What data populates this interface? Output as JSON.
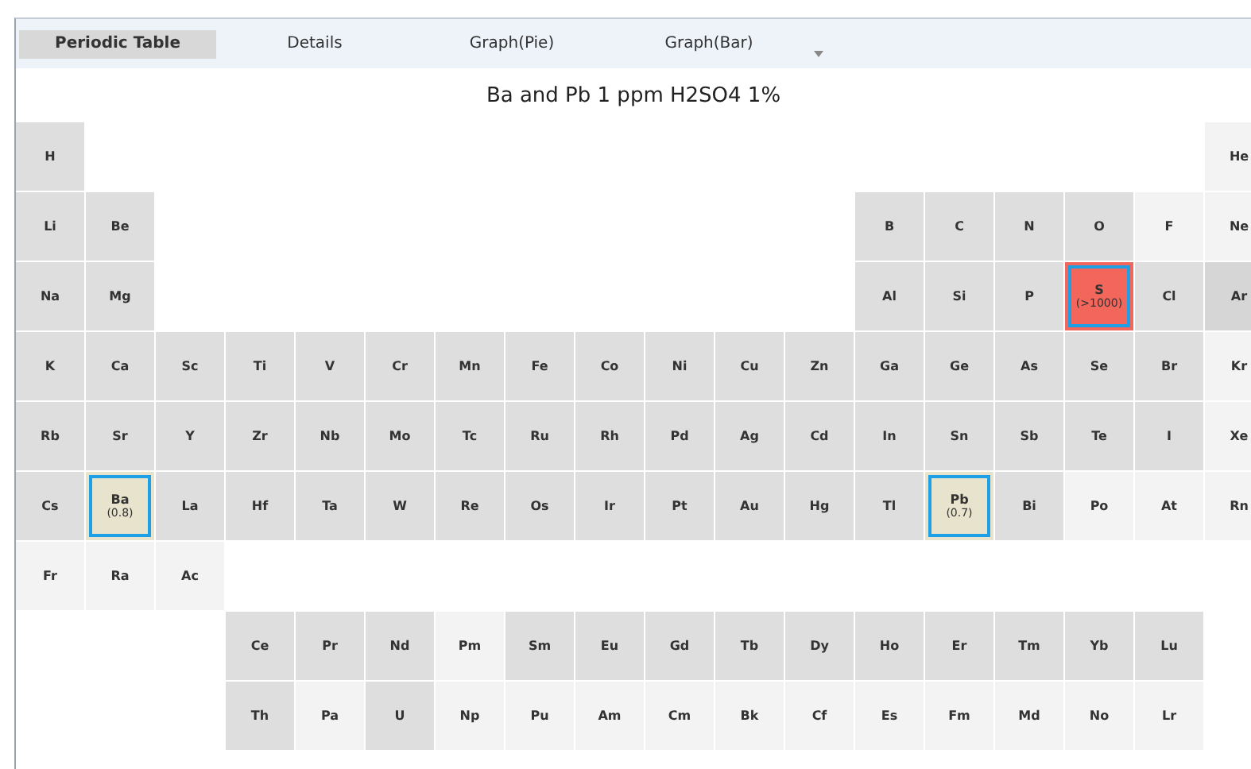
{
  "tabs": [
    {
      "label": "Periodic Table",
      "selected": true
    },
    {
      "label": "Details",
      "selected": false
    },
    {
      "label": "Graph(Pie)",
      "selected": false
    },
    {
      "label": "Graph(Bar)",
      "selected": false
    }
  ],
  "title": "Ba and Pb 1 ppm H2SO4 1%",
  "rows": [
    {
      "cells": [
        {
          "symbol": "H",
          "color": "#dedede",
          "selected": false
        },
        null,
        null,
        null,
        null,
        null,
        null,
        null,
        null,
        null,
        null,
        null,
        null,
        null,
        null,
        null,
        null,
        {
          "symbol": "He",
          "color": "#f3f3f3",
          "selected": false
        }
      ]
    },
    {
      "cells": [
        {
          "symbol": "Li",
          "color": "#dedede",
          "selected": false
        },
        {
          "symbol": "Be",
          "color": "#dedede",
          "selected": false
        },
        null,
        null,
        null,
        null,
        null,
        null,
        null,
        null,
        null,
        null,
        {
          "symbol": "B",
          "color": "#dedede",
          "selected": false
        },
        {
          "symbol": "C",
          "color": "#dedede",
          "selected": false
        },
        {
          "symbol": "N",
          "color": "#dedede",
          "selected": false
        },
        {
          "symbol": "O",
          "color": "#dedede",
          "selected": false
        },
        {
          "symbol": "F",
          "color": "#f3f3f3",
          "selected": false
        },
        {
          "symbol": "Ne",
          "color": "#f3f3f3",
          "selected": false
        }
      ]
    },
    {
      "cells": [
        {
          "symbol": "Na",
          "color": "#dedede",
          "selected": false
        },
        {
          "symbol": "Mg",
          "color": "#dedede",
          "selected": false
        },
        null,
        null,
        null,
        null,
        null,
        null,
        null,
        null,
        null,
        null,
        {
          "symbol": "Al",
          "color": "#dedede",
          "selected": false
        },
        {
          "symbol": "Si",
          "color": "#dedede",
          "selected": false
        },
        {
          "symbol": "P",
          "color": "#dedede",
          "selected": false
        },
        {
          "symbol": "S",
          "value": "(>1000)",
          "color": "#f2665b",
          "selected": true
        },
        {
          "symbol": "Cl",
          "color": "#dedede",
          "selected": false
        },
        {
          "symbol": "Ar",
          "color": "#d6d6d6",
          "selected": false
        }
      ]
    },
    {
      "cells": [
        {
          "symbol": "K",
          "color": "#dedede",
          "selected": false
        },
        {
          "symbol": "Ca",
          "color": "#dedede",
          "selected": false
        },
        {
          "symbol": "Sc",
          "color": "#dedede",
          "selected": false
        },
        {
          "symbol": "Ti",
          "color": "#dedede",
          "selected": false
        },
        {
          "symbol": "V",
          "color": "#dedede",
          "selected": false
        },
        {
          "symbol": "Cr",
          "color": "#dedede",
          "selected": false
        },
        {
          "symbol": "Mn",
          "color": "#dedede",
          "selected": false
        },
        {
          "symbol": "Fe",
          "color": "#dedede",
          "selected": false
        },
        {
          "symbol": "Co",
          "color": "#dedede",
          "selected": false
        },
        {
          "symbol": "Ni",
          "color": "#dedede",
          "selected": false
        },
        {
          "symbol": "Cu",
          "color": "#dedede",
          "selected": false
        },
        {
          "symbol": "Zn",
          "color": "#dedede",
          "selected": false
        },
        {
          "symbol": "Ga",
          "color": "#dedede",
          "selected": false
        },
        {
          "symbol": "Ge",
          "color": "#dedede",
          "selected": false
        },
        {
          "symbol": "As",
          "color": "#dedede",
          "selected": false
        },
        {
          "symbol": "Se",
          "color": "#dedede",
          "selected": false
        },
        {
          "symbol": "Br",
          "color": "#dedede",
          "selected": false
        },
        {
          "symbol": "Kr",
          "color": "#f3f3f3",
          "selected": false
        }
      ]
    },
    {
      "cells": [
        {
          "symbol": "Rb",
          "color": "#dedede",
          "selected": false
        },
        {
          "symbol": "Sr",
          "color": "#dedede",
          "selected": false
        },
        {
          "symbol": "Y",
          "color": "#dedede",
          "selected": false
        },
        {
          "symbol": "Zr",
          "color": "#dedede",
          "selected": false
        },
        {
          "symbol": "Nb",
          "color": "#dedede",
          "selected": false
        },
        {
          "symbol": "Mo",
          "color": "#dedede",
          "selected": false
        },
        {
          "symbol": "Tc",
          "color": "#dedede",
          "selected": false
        },
        {
          "symbol": "Ru",
          "color": "#dedede",
          "selected": false
        },
        {
          "symbol": "Rh",
          "color": "#dedede",
          "selected": false
        },
        {
          "symbol": "Pd",
          "color": "#dedede",
          "selected": false
        },
        {
          "symbol": "Ag",
          "color": "#dedede",
          "selected": false
        },
        {
          "symbol": "Cd",
          "color": "#dedede",
          "selected": false
        },
        {
          "symbol": "In",
          "color": "#dedede",
          "selected": false
        },
        {
          "symbol": "Sn",
          "color": "#dedede",
          "selected": false
        },
        {
          "symbol": "Sb",
          "color": "#dedede",
          "selected": false
        },
        {
          "symbol": "Te",
          "color": "#dedede",
          "selected": false
        },
        {
          "symbol": "I",
          "color": "#dedede",
          "selected": false
        },
        {
          "symbol": "Xe",
          "color": "#f3f3f3",
          "selected": false
        }
      ]
    },
    {
      "cells": [
        {
          "symbol": "Cs",
          "color": "#dedede",
          "selected": false
        },
        {
          "symbol": "Ba",
          "value": "(0.8)",
          "color": "#e7e3cc",
          "selected": true
        },
        {
          "symbol": "La",
          "color": "#dedede",
          "selected": false
        },
        {
          "symbol": "Hf",
          "color": "#dedede",
          "selected": false
        },
        {
          "symbol": "Ta",
          "color": "#dedede",
          "selected": false
        },
        {
          "symbol": "W",
          "color": "#dedede",
          "selected": false
        },
        {
          "symbol": "Re",
          "color": "#dedede",
          "selected": false
        },
        {
          "symbol": "Os",
          "color": "#dedede",
          "selected": false
        },
        {
          "symbol": "Ir",
          "color": "#dedede",
          "selected": false
        },
        {
          "symbol": "Pt",
          "color": "#dedede",
          "selected": false
        },
        {
          "symbol": "Au",
          "color": "#dedede",
          "selected": false
        },
        {
          "symbol": "Hg",
          "color": "#dedede",
          "selected": false
        },
        {
          "symbol": "Tl",
          "color": "#dedede",
          "selected": false
        },
        {
          "symbol": "Pb",
          "value": "(0.7)",
          "color": "#e7e3cc",
          "selected": true
        },
        {
          "symbol": "Bi",
          "color": "#dedede",
          "selected": false
        },
        {
          "symbol": "Po",
          "color": "#f3f3f3",
          "selected": false
        },
        {
          "symbol": "At",
          "color": "#f3f3f3",
          "selected": false
        },
        {
          "symbol": "Rn",
          "color": "#f3f3f3",
          "selected": false
        }
      ]
    },
    {
      "cells": [
        {
          "symbol": "Fr",
          "color": "#f3f3f3",
          "selected": false
        },
        {
          "symbol": "Ra",
          "color": "#f3f3f3",
          "selected": false
        },
        {
          "symbol": "Ac",
          "color": "#f3f3f3",
          "selected": false
        }
      ]
    },
    {
      "cells": [
        null,
        null,
        null,
        {
          "symbol": "Ce",
          "color": "#dedede",
          "selected": false
        },
        {
          "symbol": "Pr",
          "color": "#dedede",
          "selected": false
        },
        {
          "symbol": "Nd",
          "color": "#dedede",
          "selected": false
        },
        {
          "symbol": "Pm",
          "color": "#f3f3f3",
          "selected": false
        },
        {
          "symbol": "Sm",
          "color": "#dedede",
          "selected": false
        },
        {
          "symbol": "Eu",
          "color": "#dedede",
          "selected": false
        },
        {
          "symbol": "Gd",
          "color": "#dedede",
          "selected": false
        },
        {
          "symbol": "Tb",
          "color": "#dedede",
          "selected": false
        },
        {
          "symbol": "Dy",
          "color": "#dedede",
          "selected": false
        },
        {
          "symbol": "Ho",
          "color": "#dedede",
          "selected": false
        },
        {
          "symbol": "Er",
          "color": "#dedede",
          "selected": false
        },
        {
          "symbol": "Tm",
          "color": "#dedede",
          "selected": false
        },
        {
          "symbol": "Yb",
          "color": "#dedede",
          "selected": false
        },
        {
          "symbol": "Lu",
          "color": "#dedede",
          "selected": false
        }
      ]
    },
    {
      "cells": [
        null,
        null,
        null,
        {
          "symbol": "Th",
          "color": "#dedede",
          "selected": false
        },
        {
          "symbol": "Pa",
          "color": "#f3f3f3",
          "selected": false
        },
        {
          "symbol": "U",
          "color": "#dedede",
          "selected": false
        },
        {
          "symbol": "Np",
          "color": "#f3f3f3",
          "selected": false
        },
        {
          "symbol": "Pu",
          "color": "#f3f3f3",
          "selected": false
        },
        {
          "symbol": "Am",
          "color": "#f3f3f3",
          "selected": false
        },
        {
          "symbol": "Cm",
          "color": "#f3f3f3",
          "selected": false
        },
        {
          "symbol": "Bk",
          "color": "#f3f3f3",
          "selected": false
        },
        {
          "symbol": "Cf",
          "color": "#f3f3f3",
          "selected": false
        },
        {
          "symbol": "Es",
          "color": "#f3f3f3",
          "selected": false
        },
        {
          "symbol": "Fm",
          "color": "#f3f3f3",
          "selected": false
        },
        {
          "symbol": "Md",
          "color": "#f3f3f3",
          "selected": false
        },
        {
          "symbol": "No",
          "color": "#f3f3f3",
          "selected": false
        },
        {
          "symbol": "Lr",
          "color": "#f3f3f3",
          "selected": false
        }
      ]
    }
  ]
}
